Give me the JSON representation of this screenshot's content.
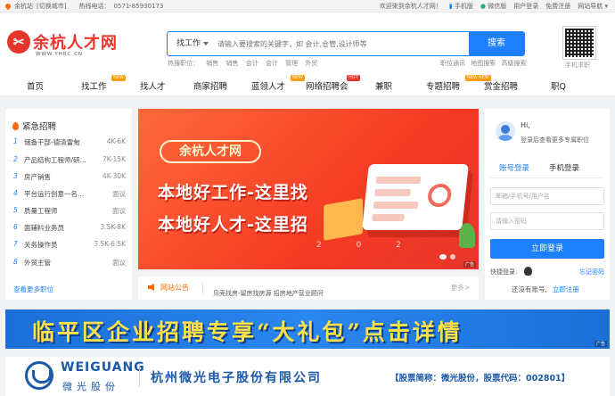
{
  "topbar": {
    "site": "余杭站",
    "switch_city": "[切换城市]",
    "hotline_label": "热线电话：",
    "hotline": "0571-85930173",
    "welcome": "欢迎来到余杭人才网！",
    "mobile": "手机版",
    "wechat": "微信版",
    "user_center": "用户登录",
    "register": "免费注册",
    "site_nav": "网站导航"
  },
  "logo": {
    "name": "余杭人才网",
    "url": "WWW.YHRC.CN"
  },
  "search": {
    "category": "找工作",
    "placeholder": "请输入要搜索的关键字，如 会计,仓管,设计师等",
    "button": "搜索",
    "hot_label": "热搜职位：",
    "hot_words": [
      "销售",
      "销售",
      "会计",
      "会计",
      "管理",
      "外贸"
    ],
    "links": [
      "职位通讯",
      "地图搜索",
      "高级搜索"
    ]
  },
  "qr": {
    "label": "手机求职"
  },
  "nav": {
    "items": [
      {
        "label": "首页",
        "badge": ""
      },
      {
        "label": "找工作",
        "badge": "NEW"
      },
      {
        "label": "找人才",
        "badge": ""
      },
      {
        "label": "商家招聘",
        "badge": ""
      },
      {
        "label": "蓝领人才",
        "badge": "NEW"
      },
      {
        "label": "网络招聘会",
        "badge": "HOT"
      },
      {
        "label": "兼职",
        "badge": ""
      },
      {
        "label": "专题招聘",
        "badge": "NEW"
      },
      {
        "label": "赏金招聘",
        "badge": "NEW"
      },
      {
        "label": "职Q",
        "badge": ""
      }
    ]
  },
  "urgent": {
    "title": "紧急招聘",
    "jobs": [
      {
        "num": "1",
        "title": "储备干部-德清雷甸",
        "salary": "4K-6K"
      },
      {
        "num": "2",
        "title": "产品结构工程师/研...",
        "salary": "7K-15K"
      },
      {
        "num": "3",
        "title": "房产销售",
        "salary": "4K-30K"
      },
      {
        "num": "4",
        "title": "平台运行创意一名...",
        "salary": "面议"
      },
      {
        "num": "5",
        "title": "质量工程师",
        "salary": "面议"
      },
      {
        "num": "6",
        "title": "面辅料业务员",
        "salary": "3.5K-8K"
      },
      {
        "num": "7",
        "title": "关务操作员",
        "salary": "3.5K-6.5K"
      },
      {
        "num": "8",
        "title": "外贸主管",
        "salary": "面议"
      }
    ],
    "more": "查看更多职位"
  },
  "banner": {
    "site": "余杭人才网",
    "line1": "本地好工作-这里找",
    "line2": "本地好人才-这里招",
    "year": "2 0 2",
    "ad": "广告"
  },
  "notice": {
    "label": "网站公告",
    "news": "贝壳找房-留房找房源 招房地产营业顾问",
    "more": "更多>"
  },
  "login": {
    "hi": "Hi,",
    "tip": "登录后查看更多专属职位",
    "tab_account": "账号登录",
    "tab_mobile": "手机登录",
    "user_placeholder": "邮箱/手机号/用户名",
    "pass_placeholder": "请输入密码",
    "button": "立即登录",
    "quick": "快捷登录:",
    "forgot": "忘记密码",
    "no_account": "还没有账号,",
    "register": "立即注册"
  },
  "promo": {
    "text": "临平区企业招聘专享“大礼包”点击详情",
    "ad": "广告"
  },
  "company": {
    "en": "WEIGUANG",
    "cn": "微光股份",
    "full_name": "杭州微光电子股份有限公司",
    "stock": "【股票简称：微光股份，股票代码：002801】"
  }
}
